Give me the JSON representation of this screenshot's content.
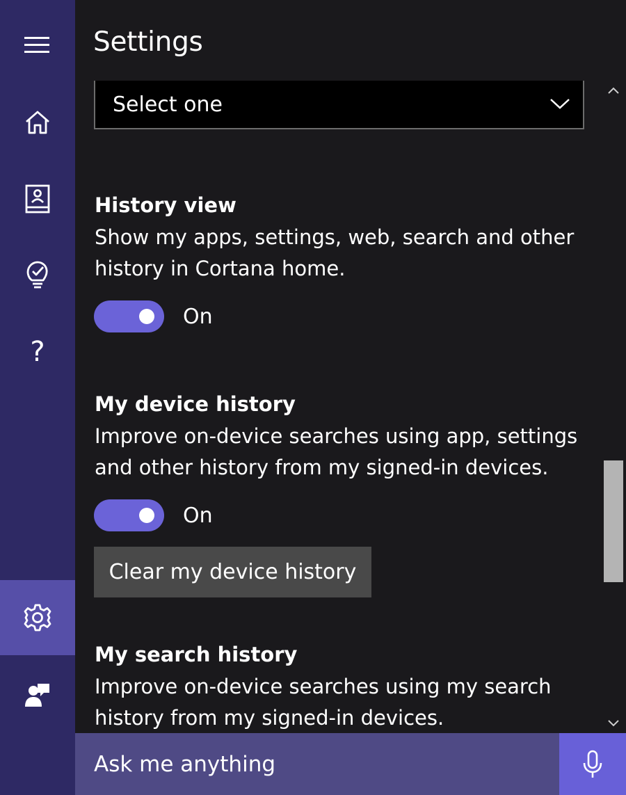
{
  "sidebar": {
    "items": [
      {
        "icon": "hamburger-menu-icon"
      },
      {
        "icon": "home-icon"
      },
      {
        "icon": "notebook-icon"
      },
      {
        "icon": "lightbulb-check-icon"
      },
      {
        "icon": "help-icon",
        "glyph": "?"
      },
      {
        "icon": "gear-icon",
        "active": true
      },
      {
        "icon": "feedback-icon"
      }
    ]
  },
  "header": {
    "title": "Settings"
  },
  "select": {
    "value": "Select one"
  },
  "sections": [
    {
      "title": "History view",
      "description": "Show my apps, settings, web, search and other history in Cortana home.",
      "toggle_label": "On",
      "toggle_on": true
    },
    {
      "title": "My device history",
      "description": "Improve on-device searches using app, settings and other history from my signed-in devices.",
      "toggle_label": "On",
      "toggle_on": true,
      "button_label": "Clear my device history"
    },
    {
      "title": "My search history",
      "description": "Improve on-device searches using my search history from my signed-in devices."
    }
  ],
  "search": {
    "placeholder": "Ask me anything"
  },
  "colors": {
    "sidebar_bg": "#2e2964",
    "sidebar_active": "#564fa8",
    "toggle_on": "#6b63d8",
    "search_bar": "#4f4a85",
    "mic_button": "#6860d8"
  }
}
